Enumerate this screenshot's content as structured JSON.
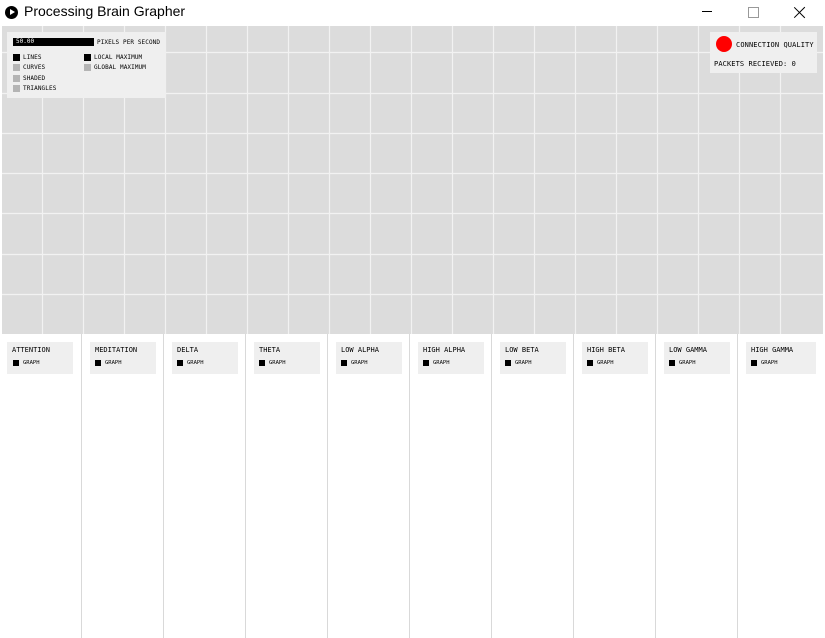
{
  "window": {
    "title": "Processing Brain Grapher",
    "controls": [
      "minimize",
      "maximize",
      "close"
    ]
  },
  "graph_controls": {
    "pixels_per_second_value": "50.00",
    "pixels_per_second_label": "PIXELS PER SECOND",
    "render_modes": [
      {
        "label": "LINES",
        "checked": true
      },
      {
        "label": "CURVES",
        "checked": false
      },
      {
        "label": "SHADED",
        "checked": false
      },
      {
        "label": "TRIANGLES",
        "checked": false
      }
    ],
    "maximum_modes": [
      {
        "label": "LOCAL MAXIMUM",
        "checked": true
      },
      {
        "label": "GLOBAL MAXIMUM",
        "checked": false
      }
    ]
  },
  "connection": {
    "quality_label": "CONNECTION QUALITY",
    "status_color": "#ff0000",
    "packets_label": "PACKETS RECIEVED: 0"
  },
  "bands": [
    {
      "name": "ATTENTION",
      "graph_label": "GRAPH",
      "checked": true
    },
    {
      "name": "MEDITATION",
      "graph_label": "GRAPH",
      "checked": true
    },
    {
      "name": "DELTA",
      "graph_label": "GRAPH",
      "checked": true
    },
    {
      "name": "THETA",
      "graph_label": "GRAPH",
      "checked": true
    },
    {
      "name": "LOW ALPHA",
      "graph_label": "GRAPH",
      "checked": true
    },
    {
      "name": "HIGH ALPHA",
      "graph_label": "GRAPH",
      "checked": true
    },
    {
      "name": "LOW BETA",
      "graph_label": "GRAPH",
      "checked": true
    },
    {
      "name": "HIGH BETA",
      "graph_label": "GRAPH",
      "checked": true
    },
    {
      "name": "LOW GAMMA",
      "graph_label": "GRAPH",
      "checked": true
    },
    {
      "name": "HIGH GAMMA",
      "graph_label": "GRAPH",
      "checked": true
    }
  ]
}
